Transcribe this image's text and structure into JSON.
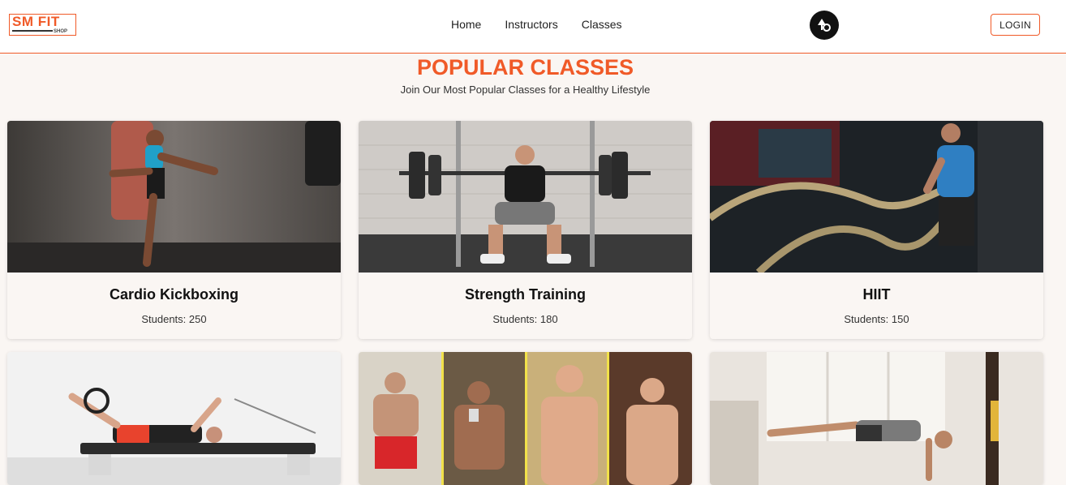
{
  "brand": {
    "logo_main": "SM FIT",
    "logo_sub": "SHOP",
    "accent_color": "#f05a28"
  },
  "nav": {
    "items": [
      {
        "label": "Home"
      },
      {
        "label": "Instructors"
      },
      {
        "label": "Classes"
      }
    ],
    "theme_toggle_icon": "theme-toggle-icon",
    "login_label": "LOGIN"
  },
  "section": {
    "title": "POPULAR CLASSES",
    "subtitle": "Join Our Most Popular Classes for a Healthy Lifestyle"
  },
  "classes": [
    {
      "name": "Cardio Kickboxing",
      "students_label": "Students:",
      "students": "250"
    },
    {
      "name": "Strength Training",
      "students_label": "Students:",
      "students": "180"
    },
    {
      "name": "HIIT",
      "students_label": "Students:",
      "students": "150"
    },
    {
      "name": "",
      "students_label": "",
      "students": ""
    },
    {
      "name": "",
      "students_label": "",
      "students": ""
    },
    {
      "name": "",
      "students_label": "",
      "students": ""
    }
  ]
}
